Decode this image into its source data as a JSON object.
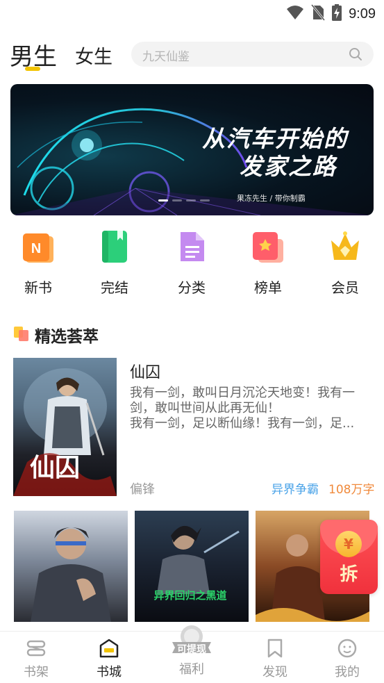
{
  "status_bar": {
    "time": "9:09"
  },
  "header": {
    "tabs": [
      {
        "label": "男生",
        "active": true
      },
      {
        "label": "女生",
        "active": false
      }
    ],
    "search_placeholder": "九天仙鉴"
  },
  "banner": {
    "title_line1": "从汽车开始的",
    "title_line2": "发家之路",
    "credit": "果冻先生 / 带你制霸",
    "slide_count": 4,
    "active_slide": 1
  },
  "categories": [
    {
      "label": "新书",
      "icon": "new-book-icon",
      "color": "#ff8a2a"
    },
    {
      "label": "完结",
      "icon": "finished-book-icon",
      "color": "#2ccf7a"
    },
    {
      "label": "分类",
      "icon": "category-icon",
      "color": "#b673e8"
    },
    {
      "label": "榜单",
      "icon": "ranking-icon",
      "color": "#ff5e6a"
    },
    {
      "label": "会员",
      "icon": "crown-icon",
      "color": "#f6b81b"
    }
  ],
  "featured_section": {
    "title": "精选荟萃",
    "book": {
      "title": "仙囚",
      "description": "我有一剑，敢叫日月沉沦天地变！我有一剑，敢叫世间从此再无仙！\n我有一剑，足以断仙缘！我有一剑，足...",
      "author": "偏锋",
      "genre": "异界争霸",
      "word_count": "108万字",
      "cover_text": "仙囚"
    },
    "cover_row": [
      {
        "cover_text": ""
      },
      {
        "cover_text": "异界回归之黑道"
      },
      {
        "cover_text": ""
      }
    ]
  },
  "red_packet": {
    "label": "拆",
    "coin_symbol": "¥"
  },
  "bottom_nav": {
    "items": [
      {
        "label": "书架",
        "icon": "bookshelf-icon",
        "active": false
      },
      {
        "label": "书城",
        "icon": "bookstore-icon",
        "active": true
      },
      {
        "label": "福利",
        "icon": "welfare-icon",
        "active": false
      },
      {
        "label": "发现",
        "icon": "bookmark-icon",
        "active": false
      },
      {
        "label": "我的",
        "icon": "profile-icon",
        "active": false
      }
    ],
    "welfare_badge": "可提现"
  },
  "colors": {
    "accent_yellow": "#f2c300",
    "genre_blue": "#4aa3e8",
    "word_count_orange": "#f08a3c",
    "red_packet": "#f0313c"
  }
}
